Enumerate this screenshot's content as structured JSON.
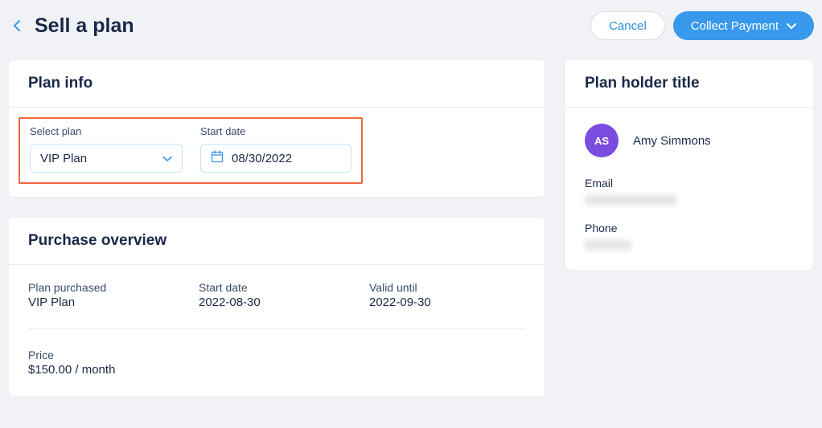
{
  "header": {
    "title": "Sell a plan",
    "cancel_label": "Cancel",
    "collect_label": "Collect Payment"
  },
  "plan_info": {
    "card_title": "Plan info",
    "select_label": "Select plan",
    "select_value": "VIP Plan",
    "date_label": "Start date",
    "date_value": "08/30/2022"
  },
  "purchase_overview": {
    "card_title": "Purchase overview",
    "plan_purchased_label": "Plan purchased",
    "plan_purchased_value": "VIP Plan",
    "start_date_label": "Start date",
    "start_date_value": "2022-08-30",
    "valid_until_label": "Valid until",
    "valid_until_value": "2022-09-30",
    "price_label": "Price",
    "price_value": "$150.00 / month"
  },
  "plan_holder": {
    "card_title": "Plan holder title",
    "initials": "AS",
    "name": "Amy Simmons",
    "email_label": "Email",
    "phone_label": "Phone"
  }
}
